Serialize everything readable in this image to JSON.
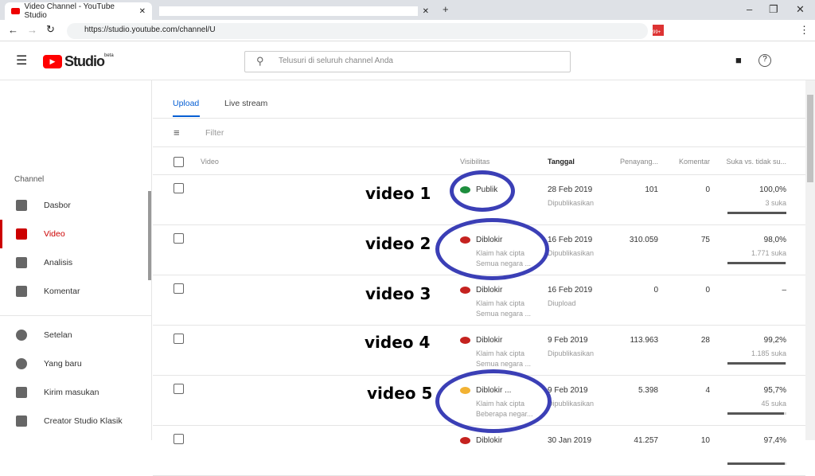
{
  "browser": {
    "tab_title": "Video Channel - YouTube Studio",
    "url": "https://studio.youtube.com/channel/U",
    "badge": "99+"
  },
  "header": {
    "logo": "Studio",
    "beta": "beta",
    "search_placeholder": "Telusuri di seluruh channel Anda"
  },
  "sidebar": {
    "section": "Channel",
    "items": [
      {
        "label": "Dasbor"
      },
      {
        "label": "Video",
        "active": true
      },
      {
        "label": "Analisis"
      },
      {
        "label": "Komentar"
      }
    ],
    "bottom": [
      {
        "label": "Setelan"
      },
      {
        "label": "Yang baru"
      },
      {
        "label": "Kirim masukan"
      },
      {
        "label": "Creator Studio Klasik"
      }
    ]
  },
  "main": {
    "tabs": [
      "Upload",
      "Live stream"
    ],
    "filter": "Filter",
    "columns": {
      "video": "Video",
      "visibility": "Visibilitas",
      "date": "Tanggal",
      "views": "Penayang...",
      "comments": "Komentar",
      "likes": "Suka vs. tidak su..."
    },
    "rows": [
      {
        "annotation": "video 1",
        "vis": "Publik",
        "vis_color": "#1e8e3e",
        "claim": "",
        "region": "",
        "date": "28 Feb 2019",
        "status": "Dipublikasikan",
        "views": "101",
        "comments": "0",
        "likes_pct": "100,0%",
        "likes": "3 suka",
        "like_ratio": 1.0
      },
      {
        "annotation": "video 2",
        "vis": "Diblokir",
        "vis_color": "#c5221f",
        "claim": "Klaim hak cipta",
        "region": "Semua negara ...",
        "date": "16 Feb 2019",
        "status": "Dipublikasikan",
        "views": "310.059",
        "comments": "75",
        "likes_pct": "98,0%",
        "likes": "1.771 suka",
        "like_ratio": 0.98
      },
      {
        "annotation": "video 3",
        "vis": "Diblokir",
        "vis_color": "#c5221f",
        "claim": "Klaim hak cipta",
        "region": "Semua negara ...",
        "date": "16 Feb 2019",
        "status": "Diupload",
        "views": "0",
        "comments": "0",
        "likes_pct": "–",
        "likes": "",
        "like_ratio": null
      },
      {
        "annotation": "video 4",
        "vis": "Diblokir",
        "vis_color": "#c5221f",
        "claim": "Klaim hak cipta",
        "region": "Semua negara ...",
        "date": "9 Feb 2019",
        "status": "Dipublikasikan",
        "views": "113.963",
        "comments": "28",
        "likes_pct": "99,2%",
        "likes": "1.185 suka",
        "like_ratio": 0.992
      },
      {
        "annotation": "video 5",
        "vis": "Diblokir ...",
        "vis_color": "#f2b233",
        "claim": "Klaim hak cipta",
        "region": "Beberapa negar...",
        "date": "9 Feb 2019",
        "status": "Dipublikasikan",
        "views": "5.398",
        "comments": "4",
        "likes_pct": "95,7%",
        "likes": "45 suka",
        "like_ratio": 0.957
      },
      {
        "annotation": "",
        "vis": "Diblokir",
        "vis_color": "#c5221f",
        "claim": "",
        "region": "",
        "date": "30 Jan 2019",
        "status": "",
        "views": "41.257",
        "comments": "10",
        "likes_pct": "97,4%",
        "likes": "",
        "like_ratio": 0.974
      }
    ]
  }
}
